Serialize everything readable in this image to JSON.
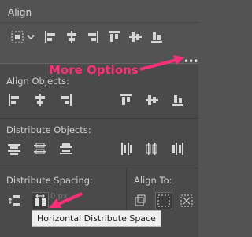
{
  "panel": {
    "title": "Align",
    "more_options_icon": "ellipsis-icon",
    "menu_icon": "panel-menu-icon"
  },
  "annotation": {
    "callout_text": "More Options",
    "color": "#ff2e78"
  },
  "flyout": {
    "align_objects_label": "Align Objects:",
    "distribute_objects_label": "Distribute Objects:",
    "distribute_spacing_label": "Distribute Spacing:",
    "align_to_label": "Align To:",
    "spacing_value": "0 px"
  },
  "tooltip": {
    "text": "Horizontal Distribute Space"
  }
}
